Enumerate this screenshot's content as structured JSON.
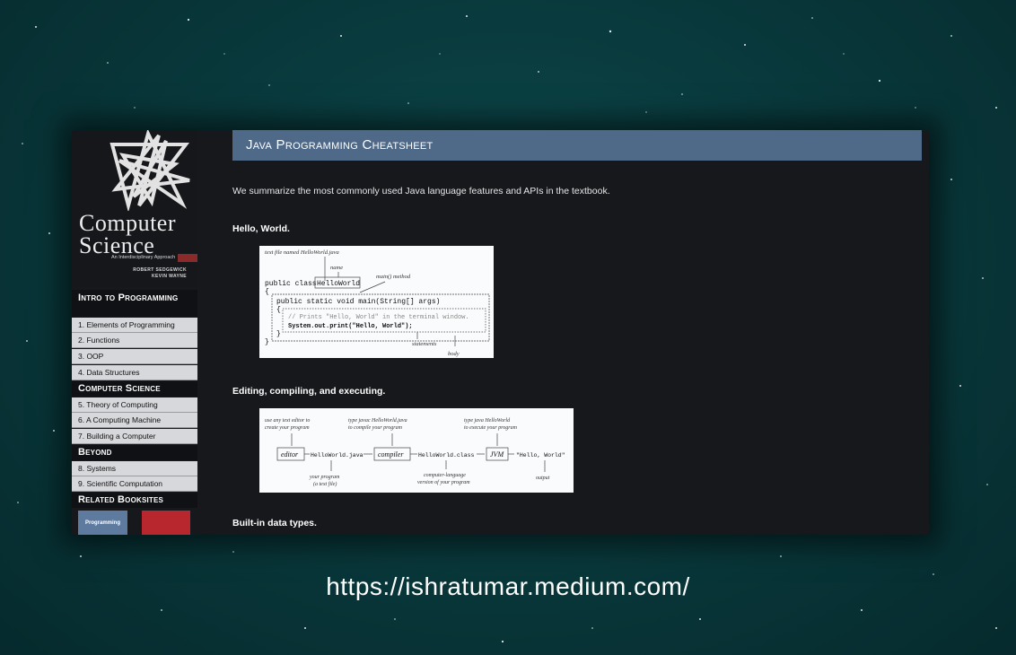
{
  "page": {
    "footer_url": "https://ishratumar.medium.com/"
  },
  "book": {
    "title_line1": "Computer",
    "title_line2": "Science",
    "subtitle": "An Interdisciplinary Approach",
    "author1": "ROBERT SEDGEWICK",
    "author2": "KEVIN WAYNE"
  },
  "sidebar": {
    "intro_header": "Intro to Programming",
    "intro_items": [
      "1.  Elements of Programming",
      "2.  Functions",
      "3.  OOP",
      "4.  Data Structures"
    ],
    "cs_header": "Computer Science",
    "cs_items": [
      "5.  Theory of Computing",
      "6.  A Computing Machine",
      "7.  Building a Computer"
    ],
    "beyond_header": "Beyond",
    "beyond_items": [
      "8.  Systems",
      "9.  Scientific Computation"
    ],
    "related_header": "Related Booksites",
    "related_thumb_label": "Programming"
  },
  "main": {
    "title": "Java Programming Cheatsheet",
    "intro": "We summarize the most commonly used Java language features and APIs in the textbook.",
    "sections": [
      "Hello, World.",
      "Editing, compiling, and executing.",
      "Built-in data types."
    ]
  },
  "fig1": {
    "file_note": "text file named HelloWorld.java",
    "name_label": "name",
    "main_label": "main() method",
    "line1_prefix": "public class",
    "class_name": "HelloWorld",
    "brace_open": "{",
    "method_sig": "public static void main(String[] args)",
    "inner_open": "{",
    "comment": "// Prints \"Hello, World\" in the terminal window.",
    "print_stmt": "System.out.print(\"Hello, World\");",
    "inner_close": "}",
    "brace_close": "}",
    "statements_label": "statements",
    "body_label": "body"
  },
  "fig2": {
    "note_editor": [
      "use any text editor to",
      "create your program"
    ],
    "note_compile": [
      "type javac HelloWorld.java",
      "to compile your program"
    ],
    "note_execute": [
      "type java HelloWorld",
      "to execute your program"
    ],
    "box_editor": "editor",
    "file_java": "HelloWorld.java",
    "box_compiler": "compiler",
    "file_class": "HelloWorld.class",
    "box_jvm": "JVM",
    "output_text": "\"Hello, World\"",
    "label_program": [
      "your program",
      "(a text file)"
    ],
    "label_bytecode": [
      "computer-language",
      "version of your program"
    ],
    "label_output": "output"
  }
}
